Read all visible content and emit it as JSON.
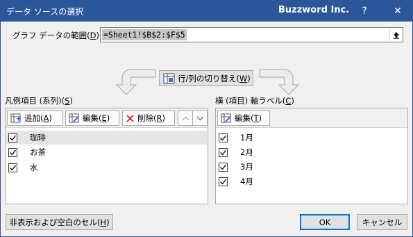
{
  "window": {
    "title": "データ ソースの選択",
    "app_name": "Buzzword Inc.",
    "help_label": "?",
    "close_label": "✕"
  },
  "range": {
    "label_prefix": "グラフ データの範囲(",
    "label_key": "D",
    "label_suffix": "):",
    "value": "=Sheet1!$B$2:$F$5"
  },
  "switch_button": {
    "label_prefix": "行/列の切り替え(",
    "key": "W",
    "label_suffix": ")"
  },
  "series_panel": {
    "label_prefix": "凡例項目 (系列)(",
    "label_key": "S",
    "label_suffix": ")",
    "add": {
      "prefix": "追加(",
      "key": "A",
      "suffix": ")"
    },
    "edit": {
      "prefix": "編集(",
      "key": "E",
      "suffix": ")"
    },
    "remove": {
      "prefix": "削除(",
      "key": "R",
      "suffix": ")"
    },
    "items": [
      {
        "label": "珈琲",
        "checked": true,
        "selected": true
      },
      {
        "label": "お茶",
        "checked": true,
        "selected": false
      },
      {
        "label": "水",
        "checked": true,
        "selected": false
      }
    ]
  },
  "category_panel": {
    "label_prefix": "横 (項目) 軸ラベル(",
    "label_key": "C",
    "label_suffix": ")",
    "edit": {
      "prefix": "編集(",
      "key": "T",
      "suffix": ")"
    },
    "items": [
      {
        "label": "1月",
        "checked": true
      },
      {
        "label": "2月",
        "checked": true
      },
      {
        "label": "3月",
        "checked": true
      },
      {
        "label": "4月",
        "checked": true
      }
    ]
  },
  "footer": {
    "hidden_cells": {
      "prefix": "非表示および空白のセル(",
      "key": "H",
      "suffix": ")"
    },
    "ok_label": "OK",
    "cancel_label": "キャンセル"
  },
  "colors": {
    "titlebar": "#2b579a",
    "dialog_bg": "#f0f0f0",
    "remove_icon": "#e81123",
    "accent": "#0078d7"
  },
  "icons": {
    "collapse": "collapse-dialog-icon",
    "switch": "switch-row-column-icon",
    "add": "add-series-icon",
    "edit": "edit-icon",
    "remove": "remove-x-icon",
    "up": "chevron-up-icon",
    "down": "chevron-down-icon",
    "check": "checkmark-icon"
  }
}
